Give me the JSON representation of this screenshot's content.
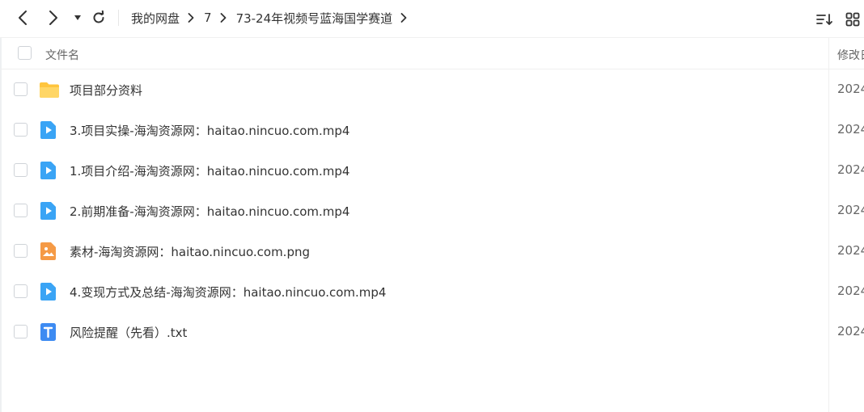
{
  "toolbar": {
    "back_icon": "chevron-left-icon",
    "forward_icon": "chevron-right-icon",
    "history_icon": "caret-down-icon",
    "refresh_icon": "refresh-icon",
    "breadcrumb": [
      "我的网盘",
      "7",
      "73-24年视频号蓝海国学赛道"
    ],
    "sort_icon": "sort-icon",
    "grid_icon": "grid-view-icon"
  },
  "header": {
    "name_label": "文件名",
    "modified_label": "修改日"
  },
  "files": [
    {
      "name": "项目部分资料",
      "type": "folder",
      "date": "2024"
    },
    {
      "name": "3.项目实操-海淘资源网：haitao.nincuo.com.mp4",
      "type": "video",
      "date": "2024"
    },
    {
      "name": "1.项目介绍-海淘资源网：haitao.nincuo.com.mp4",
      "type": "video",
      "date": "2024"
    },
    {
      "name": "2.前期准备-海淘资源网：haitao.nincuo.com.mp4",
      "type": "video",
      "date": "2024"
    },
    {
      "name": "素材-海淘资源网：haitao.nincuo.com.png",
      "type": "image",
      "date": "2024"
    },
    {
      "name": "4.变现方式及总结-海淘资源网：haitao.nincuo.com.mp4",
      "type": "video",
      "date": "2024"
    },
    {
      "name": "风险提醒（先看）.txt",
      "type": "text",
      "date": "2024"
    }
  ],
  "colors": {
    "folder": "#FFC53D",
    "video": "#3AA4F5",
    "image": "#F59A45",
    "text": "#3D8BF2",
    "icon_stroke": "#333333"
  }
}
